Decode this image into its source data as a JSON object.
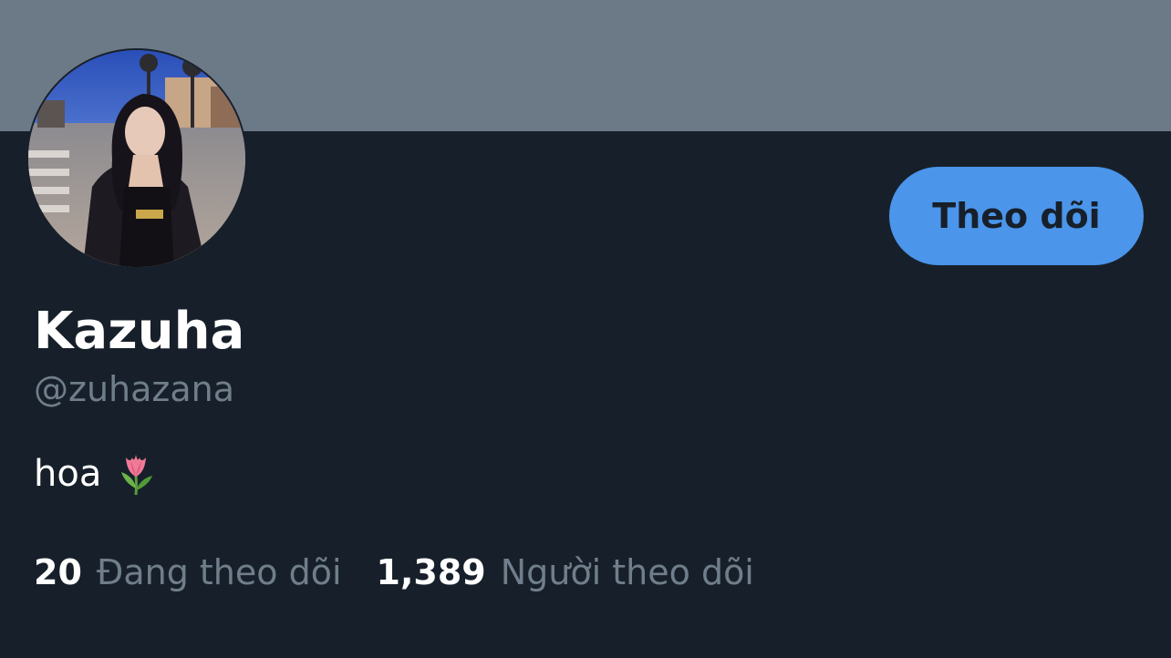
{
  "profile": {
    "display_name": "Kazuha",
    "handle": "@zuhazana",
    "bio_text": "hoa",
    "bio_emoji": "tulip-emoji",
    "follow_button_label": "Theo dõi"
  },
  "stats": {
    "following_count": "20",
    "following_label": "Đang theo dõi",
    "followers_count": "1,389",
    "followers_label": "Người theo dõi"
  },
  "colors": {
    "background": "#17202a",
    "banner": "#6c7986",
    "accent": "#4b95ea",
    "secondary_text": "#707e8b",
    "primary_text": "#ffffff"
  }
}
